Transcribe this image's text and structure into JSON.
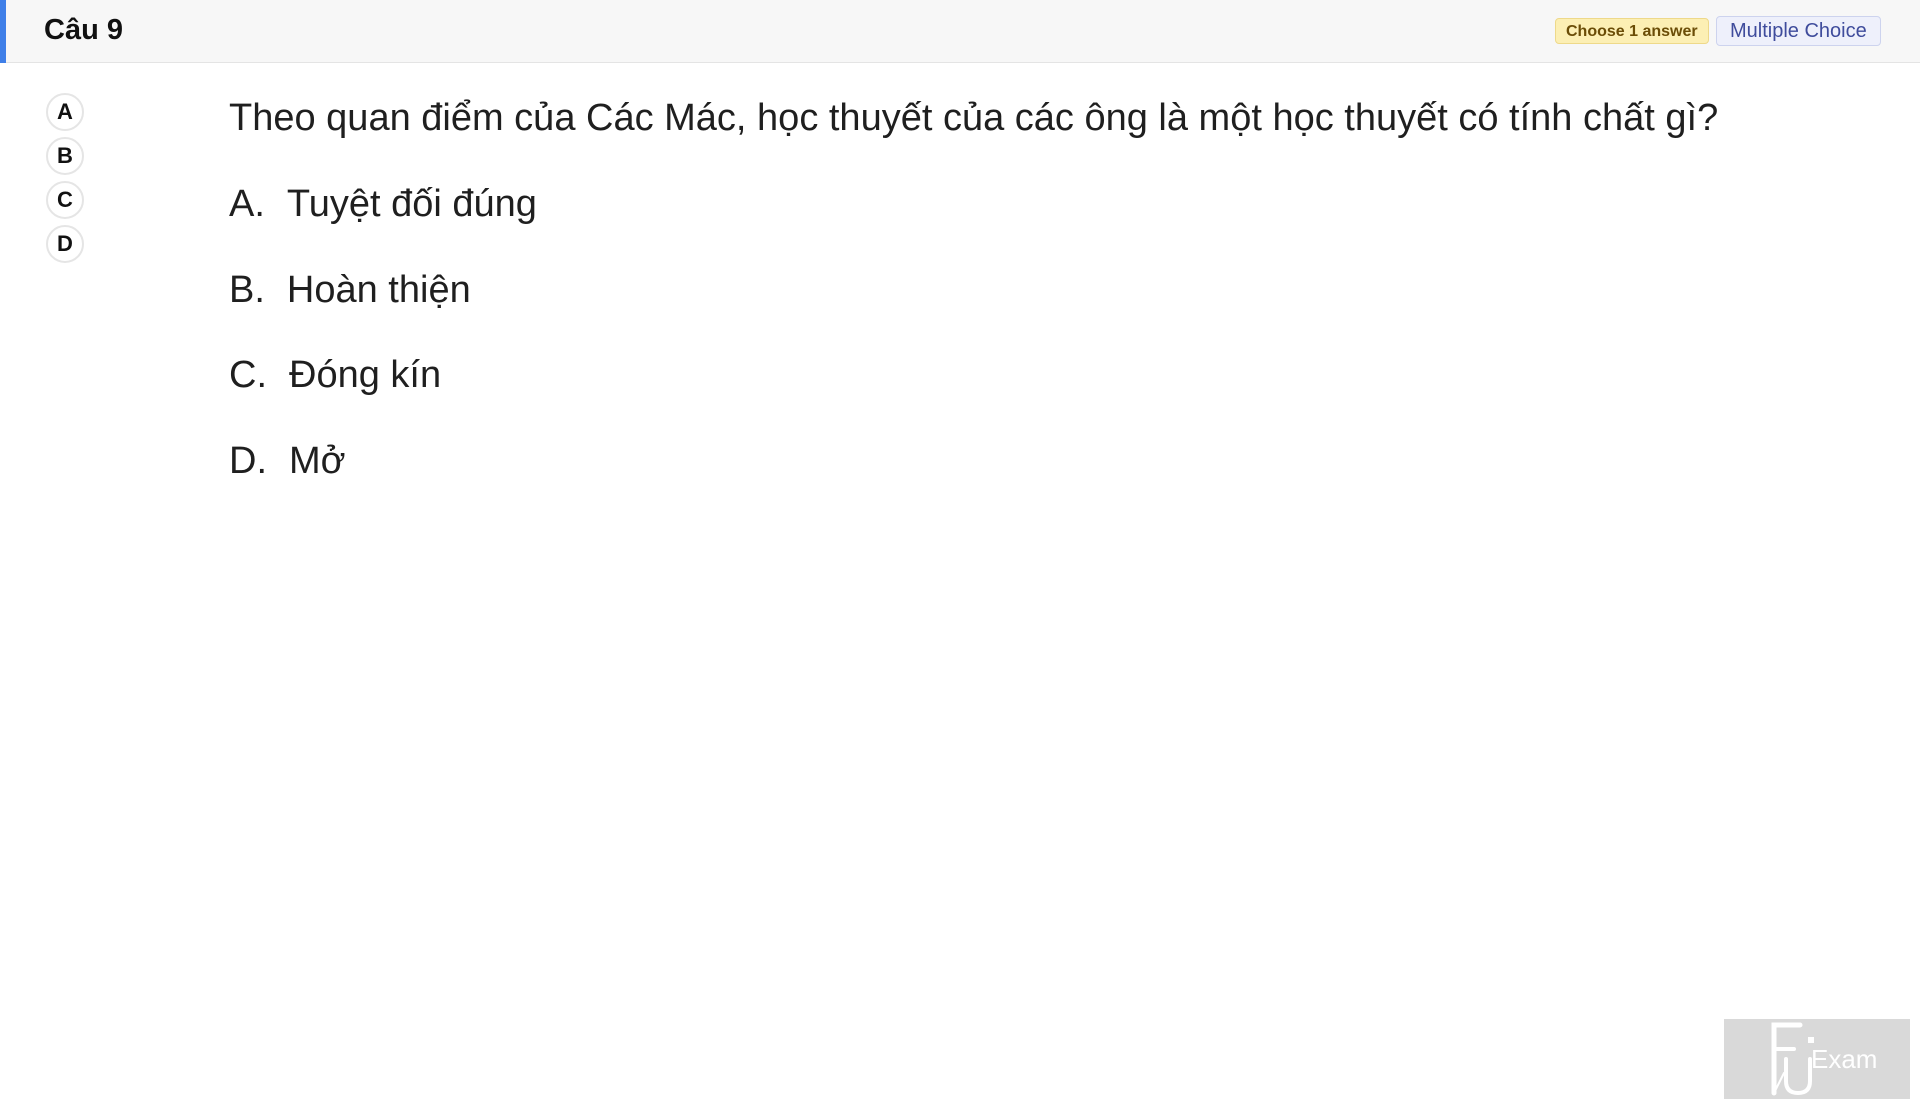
{
  "header": {
    "title": "Câu 9",
    "badge_choose": "Choose 1 answer",
    "badge_type": "Multiple Choice"
  },
  "selectors": [
    "A",
    "B",
    "C",
    "D"
  ],
  "question": {
    "text": "Theo quan điểm của Các Mác, học thuyết của các ông là một học thuyết có tính chất gì?",
    "options": [
      {
        "letter": "A.",
        "text": "Tuyệt đối đúng"
      },
      {
        "letter": "B.",
        "text": "Hoàn thiện"
      },
      {
        "letter": "C.",
        "text": "Đóng kín"
      },
      {
        "letter": "D.",
        "text": "Mở"
      }
    ]
  },
  "logo": {
    "text": "Exam",
    "icon": "fu-exam-logo"
  },
  "colors": {
    "accent": "#3f7fe8",
    "badge_choose_bg": "#fcefb4",
    "badge_type_bg": "#eef0fb"
  }
}
